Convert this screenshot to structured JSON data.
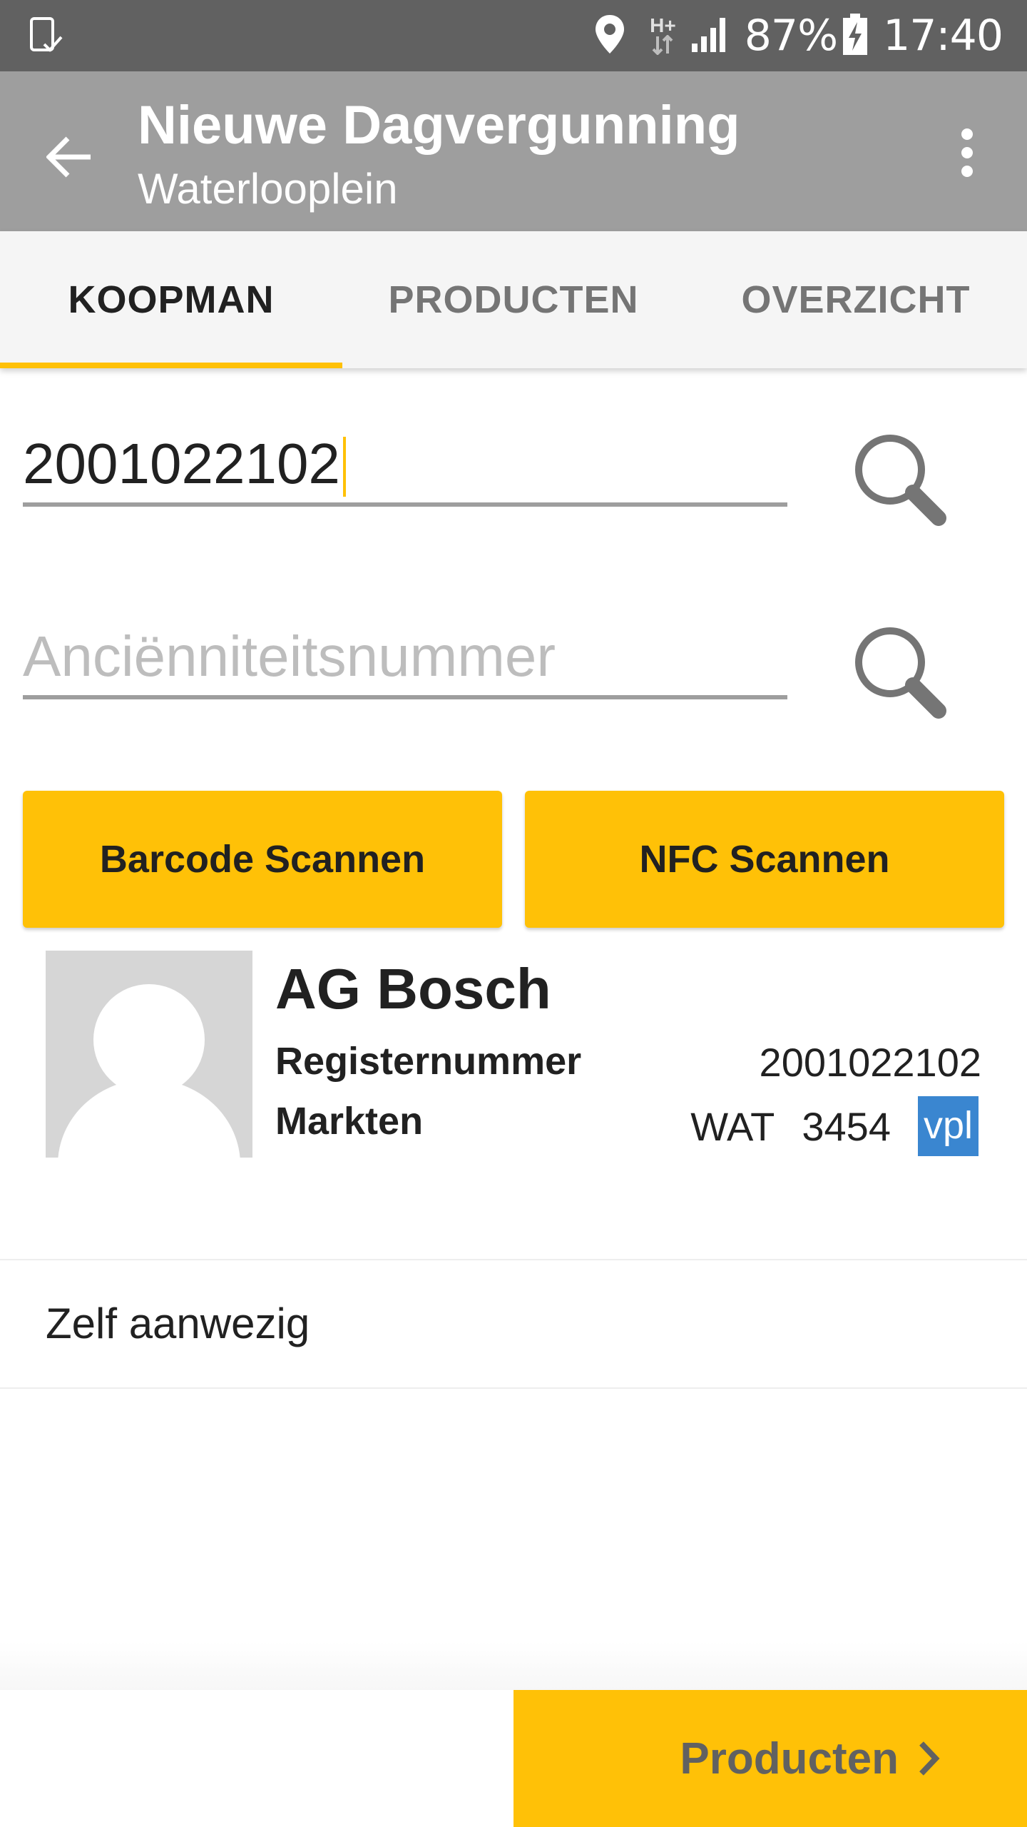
{
  "status_bar": {
    "network_type": "H+",
    "battery": "87%",
    "time": "17:40",
    "icons": [
      "screenshot-notification-icon",
      "location-icon",
      "data-arrows-icon",
      "signal-icon",
      "battery-charging-icon"
    ]
  },
  "app_bar": {
    "title": "Nieuwe Dagvergunning",
    "subtitle": "Waterlooplein",
    "back_icon": "arrow-back-icon",
    "menu_icon": "more-vert-icon"
  },
  "tabs": [
    {
      "label": "KOOPMAN",
      "active": true
    },
    {
      "label": "PRODUCTEN",
      "active": false
    },
    {
      "label": "OVERZICHT",
      "active": false
    }
  ],
  "form": {
    "register_number": {
      "value": "2001022102"
    },
    "seniority_number": {
      "placeholder": "Anciënniteitsnummer",
      "value": ""
    },
    "search_icon": "search-icon"
  },
  "buttons": {
    "barcode": "Barcode Scannen",
    "nfc": "NFC Scannen",
    "next": "Producten"
  },
  "merchant": {
    "name": "AG Bosch",
    "register_label": "Registernummer",
    "register_value": "2001022102",
    "markets_label": "Markten",
    "market_code": "WAT",
    "market_number": "3454",
    "market_badge": "vpl"
  },
  "presence": {
    "label": "Zelf aanwezig"
  },
  "colors": {
    "status_bar": "#616161",
    "app_bar": "#9e9e9e",
    "accent": "#ffc107",
    "badge": "#3a86d0"
  }
}
